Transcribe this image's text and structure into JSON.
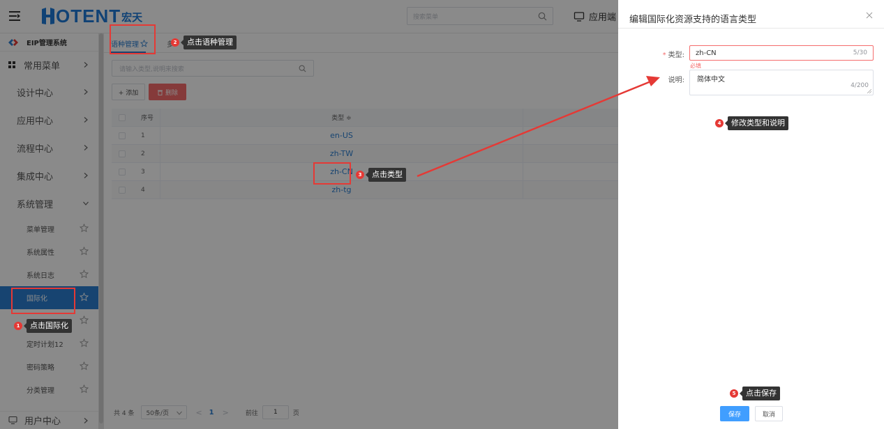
{
  "header": {
    "brand": "OTENT",
    "brand_cn": "宏天",
    "search_placeholder": "搜索菜单",
    "app_entry_label": "应用端"
  },
  "sidebar": {
    "system_title": "EIP管理系统",
    "top_menu": "常用菜单",
    "groups": [
      {
        "label": "设计中心"
      },
      {
        "label": "应用中心"
      },
      {
        "label": "流程中心"
      },
      {
        "label": "集成中心"
      },
      {
        "label": "系统管理"
      }
    ],
    "sub_items": [
      {
        "label": "菜单管理"
      },
      {
        "label": "系统属性"
      },
      {
        "label": "系统日志"
      },
      {
        "label": "国际化"
      },
      {
        "label": ""
      },
      {
        "label": "定时计划12"
      },
      {
        "label": "密码策略"
      },
      {
        "label": "分类管理"
      }
    ],
    "bottom_item": "用户中心"
  },
  "content": {
    "active_tab": "语种管理",
    "second_tab_partial": "多",
    "search_placeholder": "请输入类型,说明来搜索",
    "add_button": "+ 添加",
    "delete_button": "删除",
    "table": {
      "headers": {
        "no": "序号",
        "type": "类型 ≑"
      },
      "rows": [
        {
          "no": "1",
          "type": "en-US"
        },
        {
          "no": "2",
          "type": "zh-TW"
        },
        {
          "no": "3",
          "type": "zh-CN"
        },
        {
          "no": "4",
          "type": "zh-tg"
        }
      ]
    },
    "pager": {
      "total": "共 4 条",
      "page_size": "50条/页",
      "prev": "<",
      "current": "1",
      "next": ">",
      "goto_label": "前往",
      "goto_value": "1",
      "page_unit": "页"
    }
  },
  "dialog": {
    "title": "编辑国际化资源支持的语言类型",
    "type_label": "类型:",
    "type_value": "zh-CN",
    "type_count": "5/30",
    "type_error": "必填",
    "desc_label": "说明:",
    "desc_value": "简体中文",
    "desc_count": "4/200",
    "save_button": "保存",
    "cancel_button": "取消"
  },
  "annotations": [
    {
      "num": "1",
      "text": "点击国际化"
    },
    {
      "num": "2",
      "text": "点击语种管理"
    },
    {
      "num": "3",
      "text": "点击类型"
    },
    {
      "num": "4",
      "text": "修改类型和说明"
    },
    {
      "num": "5",
      "text": "点击保存"
    }
  ],
  "colors": {
    "primary": "#2c7fd1",
    "danger": "#f56c6c",
    "annotation_red": "#e53935",
    "save_blue": "#409eff"
  }
}
